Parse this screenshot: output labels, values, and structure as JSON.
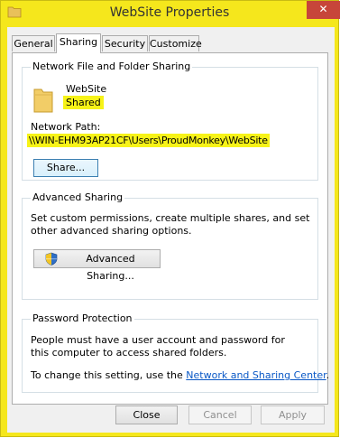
{
  "window": {
    "title": "WebSite Properties",
    "close_glyph": "✕"
  },
  "tabs": [
    {
      "label": "General",
      "active": false
    },
    {
      "label": "Sharing",
      "active": true
    },
    {
      "label": "Security",
      "active": false
    },
    {
      "label": "Customize",
      "active": false
    }
  ],
  "network_sharing": {
    "title": "Network File and Folder Sharing",
    "folder_name": "WebSite",
    "status": "Shared",
    "path_label": "Network Path:",
    "path": "\\\\WIN-EHM93AP21CF\\Users\\ProudMonkey\\WebSite",
    "share_button": "Share..."
  },
  "advanced_sharing": {
    "title": "Advanced Sharing",
    "description": "Set custom permissions, create multiple shares, and set other advanced sharing options.",
    "button": "Advanced Sharing..."
  },
  "password_protection": {
    "title": "Password Protection",
    "description": "People must have a user account and password for this computer to access shared folders.",
    "change_prefix": "To change this setting, use the ",
    "link": "Network and Sharing Center",
    "change_suffix": "."
  },
  "footer": {
    "close": "Close",
    "cancel": "Cancel",
    "apply": "Apply"
  },
  "colors": {
    "highlight": "#f7f318",
    "link": "#0a58c6",
    "close_button": "#c7453a"
  },
  "icons": [
    "folder-icon",
    "shield-icon",
    "close-icon"
  ]
}
